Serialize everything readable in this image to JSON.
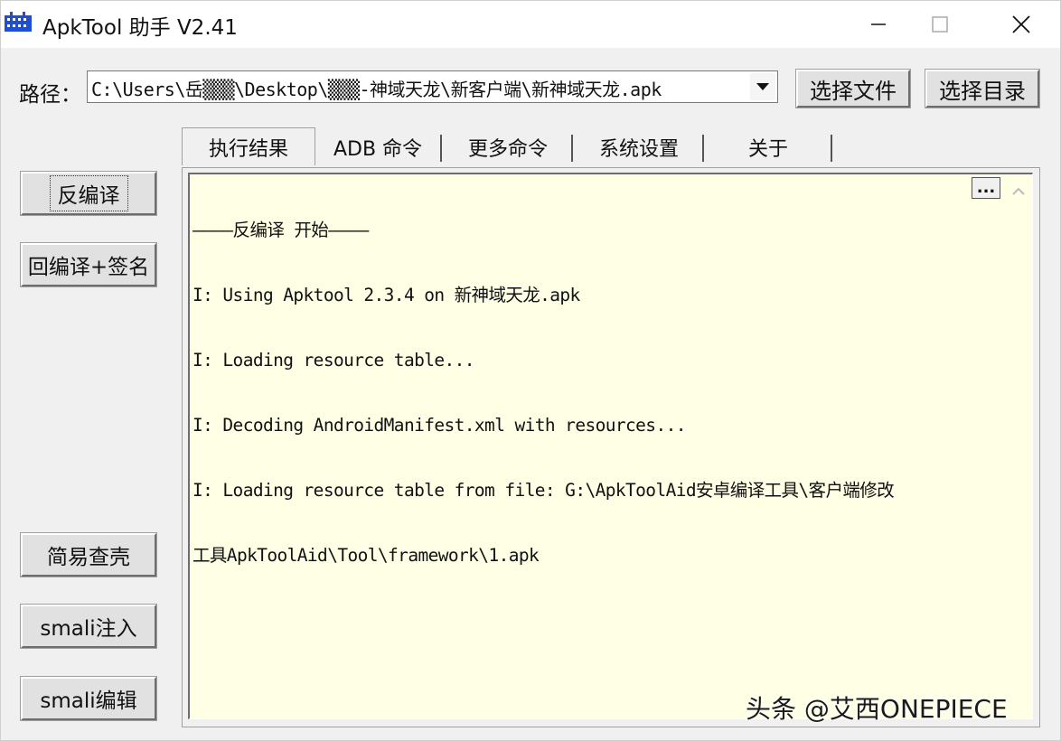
{
  "window": {
    "title": "ApkTool 助手 V2.41"
  },
  "path": {
    "label": "路径：",
    "value": "C:\\Users\\岳▒▒▒\\Desktop\\▒▒▒-神域天龙\\新客户端\\新神域天龙.apk",
    "select_file_label": "选择文件",
    "select_dir_label": "选择目录"
  },
  "tabs": [
    {
      "label": "执行结果",
      "active": true
    },
    {
      "label": "ADB 命令",
      "active": false
    },
    {
      "label": "更多命令",
      "active": false
    },
    {
      "label": "系统设置",
      "active": false
    },
    {
      "label": "关于",
      "active": false
    }
  ],
  "side_buttons": {
    "decompile": "反编译",
    "recompile_sign": "回编译+签名",
    "check_shell": "简易查壳",
    "smali_inject": "smali注入",
    "smali_edit": "smali编辑"
  },
  "output": {
    "more_label": "...",
    "lines": [
      "————反编译 开始————",
      "I: Using Apktool 2.3.4 on 新神域天龙.apk",
      "I: Loading resource table...",
      "I: Decoding AndroidManifest.xml with resources...",
      "I: Loading resource table from file: G:\\ApkToolAid安卓编译工具\\客户端修改",
      "工具ApkToolAid\\Tool\\framework\\1.apk"
    ]
  },
  "watermark": "头条 @艾西ONEPIECE",
  "colors": {
    "output_bg": "#ffffe6",
    "window_bg": "#f0f0f0",
    "icon_blue": "#1f4fd1"
  }
}
